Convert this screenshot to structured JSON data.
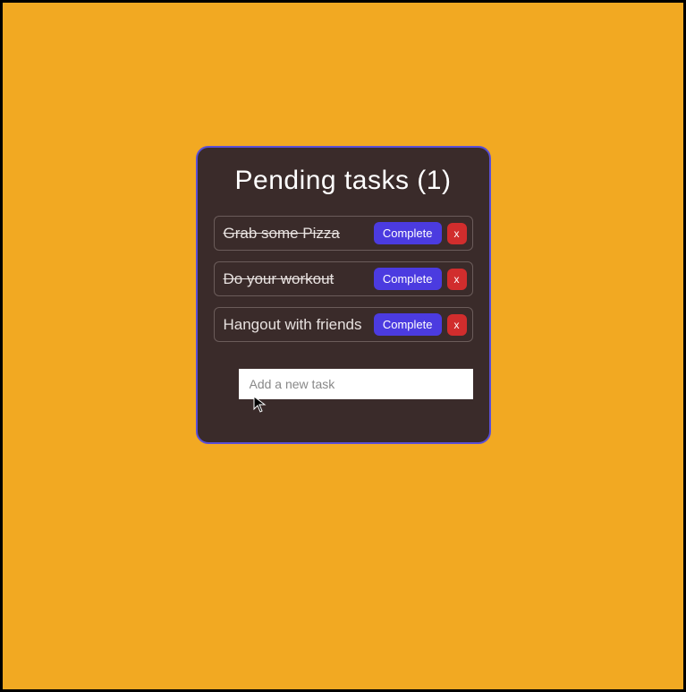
{
  "header": {
    "title_prefix": "Pending tasks",
    "pending_count": 1
  },
  "tasks": [
    {
      "label": "Grab some Pizza",
      "completed": true
    },
    {
      "label": "Do your workout",
      "completed": true
    },
    {
      "label": "Hangout with friends",
      "completed": false
    }
  ],
  "buttons": {
    "complete_label": "Complete",
    "delete_label": "x"
  },
  "input": {
    "placeholder": "Add a new task",
    "value": ""
  },
  "computed": {
    "title_full": "Pending tasks (1)"
  }
}
